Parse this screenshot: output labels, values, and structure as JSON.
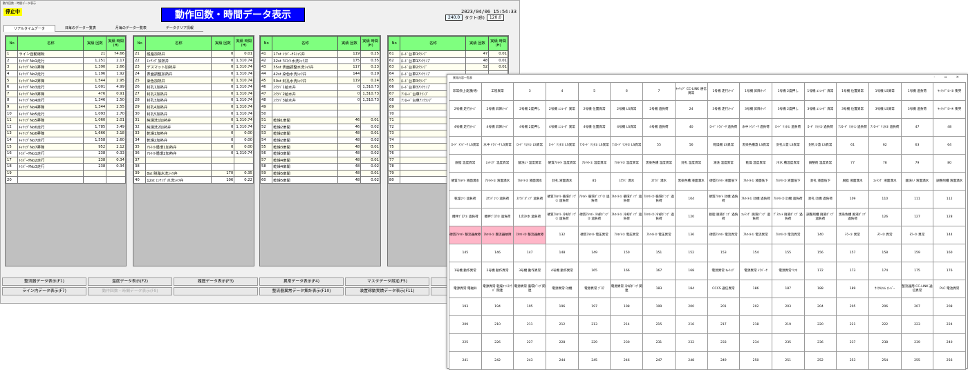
{
  "window1": {
    "title": "動作回数・時間データ表示",
    "status": "停止中",
    "heading": "動作回数・時間データ表示",
    "datetime": "2023/04/06 15:54:33",
    "cycle": "240.0",
    "takt_label": "タクト(秒)",
    "takt": "120.0",
    "tabs": [
      "リアルタイムデータ",
      "日毎のデータ一覧表",
      "月毎のデータ一覧表",
      "データクリア情報"
    ],
    "headers": {
      "no": "No",
      "name": "名称",
      "count": "実績 回数",
      "time": "実績 時間(H)"
    },
    "panels": [
      {
        "rows": [
          [
            "1",
            "ライン自動運転",
            "21",
            "74.66"
          ],
          [
            "2",
            "ｷｬﾘｯﾂﾞNo1走行",
            "1,251",
            "2.17"
          ],
          [
            "3",
            "ｷｬﾘｯﾂﾞNo1昇降",
            "1,390",
            "2.66"
          ],
          [
            "4",
            "ｷｬﾘｯﾂﾞNo2走行",
            "1,196",
            "1.92"
          ],
          [
            "5",
            "ｷｬﾘｯﾂﾞNo2昇降",
            "1,544",
            "2.95"
          ],
          [
            "6",
            "ｷｬﾘｯﾂﾞNo3走行",
            "1,001",
            "4.99"
          ],
          [
            "7",
            "ｷｬﾘｯﾂﾞNo3昇降",
            "476",
            "0.91"
          ],
          [
            "8",
            "ｷｬﾘｯﾂﾞNo4走行",
            "1,346",
            "2.50"
          ],
          [
            "9",
            "ｷｬﾘｯﾂﾞNo4昇降",
            "1,344",
            "2.55"
          ],
          [
            "10",
            "ｷｬﾘｯﾂﾞNo5走行",
            "1,093",
            "2.70"
          ],
          [
            "11",
            "ｷｬﾘｯﾂﾞNo5昇降",
            "1,060",
            "2.01"
          ],
          [
            "12",
            "ｷｬﾘｯﾂﾞNo6走行",
            "1,785",
            "3.49"
          ],
          [
            "13",
            "ｷｬﾘｯﾂﾞNo6昇降",
            "1,666",
            "3.18"
          ],
          [
            "14",
            "ｷｬﾘｯﾂﾞNo7走行",
            "1,558",
            "2.60"
          ],
          [
            "15",
            "ｷｬﾘｯﾂﾞNo7昇降",
            "952",
            "2.12"
          ],
          [
            "16",
            "ﾄﾗﾊﾞｰｻNo1走行",
            "238",
            "0.33"
          ],
          [
            "17",
            "ﾄﾗﾊﾞｰｻNo2走行",
            "238",
            "0.34"
          ],
          [
            "18",
            "ﾄﾗﾊﾞｰｻNo3走行",
            "238",
            "0.34"
          ],
          [
            "19",
            "",
            "",
            ""
          ],
          [
            "20",
            "",
            "",
            ""
          ]
        ]
      },
      {
        "rows": [
          [
            "21",
            "脱脂加熱弁",
            "0",
            "0.01"
          ],
          [
            "22",
            "ｴｯﾁﾝｸﾞ加熱弁",
            "0",
            "1,310.74"
          ],
          [
            "23",
            "デスマット加熱弁",
            "0",
            "1,310.74"
          ],
          [
            "24",
            "表面調整加熱弁",
            "0",
            "1,310.74"
          ],
          [
            "25",
            "染色加熱弁",
            "0",
            "1,310.74"
          ],
          [
            "26",
            "封孔1加熱弁",
            "0",
            "1,310.74"
          ],
          [
            "27",
            "封孔2加熱弁",
            "0",
            "1,310.74"
          ],
          [
            "28",
            "封孔3加熱弁",
            "0",
            "1,310.74"
          ],
          [
            "29",
            "封孔4加熱弁",
            "0",
            "1,310.74"
          ],
          [
            "30",
            "封孔5加熱弁",
            "0",
            "1,310.74"
          ],
          [
            "31",
            "純湯洗1加熱弁",
            "0",
            "1,310.74"
          ],
          [
            "32",
            "純湯洗2加熱弁",
            "0",
            "1,310.74"
          ],
          [
            "33",
            "乾燥1加熱弁",
            "0",
            "0.00"
          ],
          [
            "34",
            "乾燥2加熱弁",
            "0",
            "0.00"
          ],
          [
            "35",
            "ｱﾙﾏｲﾄ循環1加熱弁",
            "0",
            "0.00"
          ],
          [
            "36",
            "ｱﾙﾏｲﾄ循環2加熱弁",
            "0",
            "1,310.74"
          ],
          [
            "37",
            "",
            "",
            ""
          ],
          [
            "38",
            "",
            "",
            ""
          ],
          [
            "39",
            "8st 脱脂水洗ｼｬﾜ弁",
            "170",
            "0.35"
          ],
          [
            "40",
            "12st ｴｯﾁﾝｸﾞ水洗ｼｬﾜ弁",
            "106",
            "0.22"
          ]
        ]
      },
      {
        "rows": [
          [
            "41",
            "17st ﾄﾗﾊﾞｰｻ1ｼｬﾜ弁",
            "119",
            "0.25"
          ],
          [
            "42",
            "32st ｱﾙﾏｲﾄ水洗ｼｬﾜ弁",
            "175",
            "0.35"
          ],
          [
            "43",
            "35st 表面調整水洗ｼｬﾜ弁",
            "117",
            "0.23"
          ],
          [
            "44",
            "42st 染色水洗ｼｬﾜ弁",
            "144",
            "0.29"
          ],
          [
            "45",
            "50st 封孔水洗ｼｬﾜ弁",
            "119",
            "0.24"
          ],
          [
            "46",
            "ｽｸﾗﾊﾞ1給水弁",
            "0",
            "1,310.73"
          ],
          [
            "47",
            "ｽｸﾗﾊﾞ2給水弁",
            "0",
            "1,310.73"
          ],
          [
            "48",
            "ｽｸﾗﾊﾞ3給水弁",
            "0",
            "1,310.73"
          ],
          [
            "49",
            "",
            "",
            ""
          ],
          [
            "50",
            "",
            "",
            ""
          ],
          [
            "51",
            "乾燥1扉開",
            "46",
            "0.01"
          ],
          [
            "52",
            "乾燥2扉開",
            "46",
            "0.02"
          ],
          [
            "53",
            "乾燥2扉開",
            "48",
            "0.01"
          ],
          [
            "54",
            "乾燥2扉開",
            "48",
            "0.02"
          ],
          [
            "55",
            "乾燥3扉開",
            "48",
            "0.01"
          ],
          [
            "56",
            "乾燥3扉開",
            "48",
            "0.02"
          ],
          [
            "57",
            "乾燥4扉開",
            "48",
            "0.01"
          ],
          [
            "58",
            "乾燥4扉開",
            "48",
            "0.02"
          ],
          [
            "59",
            "乾燥5扉開",
            "48",
            "0.01"
          ],
          [
            "60",
            "乾燥5扉開",
            "48",
            "0.02"
          ]
        ]
      },
      {
        "rows": [
          [
            "61",
            "ﾛｰﾄﾞ台車1ｸﾗﾝﾌﾟ",
            "47",
            "0.01"
          ],
          [
            "62",
            "ﾛｰﾄﾞ台車1ｱﾝｸﾗﾝﾌﾟ",
            "48",
            "0.01"
          ],
          [
            "63",
            "ﾛｰﾄﾞ台車2ｸﾗﾝﾌﾟ",
            "52",
            "0.01"
          ],
          [
            "64",
            "ﾛｰﾄﾞ台車2ｱﾝｸﾗﾝﾌﾟ",
            "",
            ""
          ],
          [
            "65",
            "ﾛｰﾄﾞ台車3ｸﾗﾝﾌﾟ",
            "",
            ""
          ],
          [
            "66",
            "ﾛｰﾄﾞ台車3ｱﾝｸﾗﾝﾌﾟ",
            "",
            ""
          ],
          [
            "67",
            "ｱﾝﾛｰﾄﾞ台車ｸﾗﾝﾌﾟ",
            "",
            ""
          ],
          [
            "68",
            "ｱﾝﾛｰﾄﾞ台車ｱﾝｸﾗﾝﾌﾟ",
            "",
            ""
          ],
          [
            "69",
            "",
            "",
            ""
          ],
          [
            "70",
            "",
            "",
            ""
          ],
          [
            "71",
            "",
            "",
            ""
          ],
          [
            "72",
            "",
            "",
            ""
          ],
          [
            "73",
            "",
            "",
            ""
          ],
          [
            "74",
            "",
            "",
            ""
          ],
          [
            "75",
            "",
            "",
            ""
          ],
          [
            "76",
            "",
            "",
            ""
          ],
          [
            "77",
            "",
            "",
            ""
          ],
          [
            "78",
            "",
            "",
            ""
          ],
          [
            "79",
            "",
            "",
            ""
          ],
          [
            "80",
            "",
            "",
            ""
          ]
        ]
      }
    ],
    "buttons_row1": [
      "整流器データ表示(F1)",
      "温度データ表示(F2)",
      "履歴データ表示(F3)",
      "異常データ表示(F4)",
      "マスタデータ設定(F5)",
      ""
    ],
    "buttons_row2": [
      "ライン内データ表示(F7)",
      "動作回数・時間データ表示(F8)",
      "",
      "整流器異常データ集計表示(F10)",
      "装置稼動実績データ表示(F11)",
      ""
    ]
  },
  "window2": {
    "title": "異常内容一覧表",
    "controls": "- ▫ ×",
    "cells": [
      "非常停止(起動待)",
      "工程異常",
      "3",
      "4",
      "5",
      "6",
      "7",
      "ｷｬﾘｯﾂﾞ CC-LINK 通信異常",
      "1号機 走行ｵｰﾊﾞ",
      "1号機 昇降ｵｰﾊﾞ",
      "1号機 2度押し",
      "1号機 ｴﾝｺｰﾀﾞ 異常",
      "1号機 位置異常",
      "1号機 LS異常",
      "1号機 過負荷",
      "ｷｬﾘｯﾂﾞ①-② 衝突",
      "2号機 走行ｵｰﾊﾞ",
      "2号機 昇降ｵｰﾊﾞ",
      "2号機 2度押し",
      "2号機 ｴﾝｺｰﾀﾞ 異常",
      "2号機 位置異常",
      "2号機 LS異常",
      "2号機 過負荷",
      "24",
      "3号機 走行ｵｰﾊﾞ",
      "3号機 昇降ｵｰﾊﾞ",
      "3号機 2度押し",
      "3号機 ｴﾝｺｰﾀﾞ 異常",
      "3号機 位置異常",
      "3号機 LS異常",
      "3号機 過負荷",
      "ｷｬﾘｯﾂﾞ③-④ 衝突",
      "4号機 走行ｵｰﾊﾞ",
      "4号機 昇降ｵｰﾊﾞ",
      "4号機 2度押し",
      "4号機 ｴﾝｺｰﾀﾞ 異常",
      "4号機 位置異常",
      "4号機 LS異常",
      "4号機 過負荷",
      "40",
      "ﾛｰﾄﾞ ﾄﾗﾊﾞｰｻ 過負荷",
      "水中 ﾄﾗﾊﾞｰｻ 過負荷",
      "ﾛｰﾄﾞ ﾘﾌﾀ① 過負荷",
      "ﾛｰﾄﾞ ﾘﾌﾀ② 過負荷",
      "ｱﾝﾛｰﾄﾞ ﾘﾌﾀ① 過負荷",
      "ｱﾝﾛｰﾄﾞ ﾘﾌﾀ② 過負荷",
      "47",
      "48",
      "ﾛｰﾄﾞ ﾄﾗﾊﾞｰｻ LS異常",
      "水中 ﾄﾗﾊﾞｰｻ LS異常",
      "ﾛｰﾄﾞ ﾘﾌﾀ① LS異常",
      "ﾛｰﾄﾞ ﾘﾌﾀ② LS異常",
      "ｱﾝﾛｰﾄﾞ ﾘﾌﾀ① LS異常",
      "ｱﾝﾛｰﾄﾞ ﾘﾌﾀ② LS異常",
      "55",
      "56",
      "乾燥機 LS異常",
      "黒染色槽蓋 LS異常",
      "封孔①蓋 LS異常",
      "封孔②蓋 LS異常",
      "61",
      "62",
      "63",
      "64",
      "脱脂 温度異常",
      "ｴｯﾁﾝｸﾞ 温度異常",
      "酸洗い 温度異常",
      "硬質ｱﾙﾏｲﾄ 温度異常",
      "ｱﾙﾏｲﾄ① 温度異常",
      "ｱﾙﾏｲﾄ② 温度異常",
      "黒染色槽 温度異常",
      "封孔 温度異常",
      "湯洗 温度異常",
      "乾燥 温度異常",
      "冷水 槽温度異常",
      "調整剤 温度異常",
      "77",
      "78",
      "79",
      "80",
      "硬質ｱﾙﾏｲﾄ 液面満水",
      "ｱﾙﾏｲﾄ① 液面満水",
      "ｱﾙﾏｲﾄ② 液面満水",
      "封孔 液面満水",
      "85",
      "ｽｸﾗﾊﾞ 満水",
      "ｽｸﾗﾊﾞ 満水",
      "黒染色槽 液面満水",
      "硬質ｱﾙﾏｲﾄ 液面低下",
      "ｱﾙﾏｲﾄ① 液面低下",
      "ｱﾙﾏｲﾄ② 液面低下",
      "封孔 液面低下",
      "脱脂 液面満水",
      "ｴｯﾁﾝｸﾞ 液面満水",
      "酸洗い 液面満水",
      "調整剤槽 液面満水",
      "乾燥ﾌｧﾝ 過負荷",
      "ｽｸﾗﾊﾞﾌｧﾝ 過負荷",
      "ｽｸﾗﾊﾞﾎﾟﾝﾌﾟ 過負荷",
      "硬質ｱﾙﾏｲﾄ 循環ﾎﾟﾝﾌﾟ① 過負荷",
      "ｱﾙﾏｲﾄ 循環ﾎﾟﾝﾌﾟ② 過負荷",
      "ｱﾙﾏｲﾄ① 循環ﾎﾟﾝﾌﾟ 過負荷",
      "ｱﾙﾏｲﾄ② 循環ﾎﾟﾝﾌﾟ 過負荷",
      "104",
      "硬質ｱﾙﾏｲﾄ ﾛｶ機 過負荷",
      "ｱﾙﾏｲﾄ① ﾛｶ機 過負荷",
      "ｱﾙﾏｲﾄ② ﾛｶ機 過負荷",
      "封孔 ﾛｶ機 過負荷",
      "109",
      "110",
      "111",
      "112",
      "攪拌ﾌﾞﾛｱ① 過負荷",
      "攪拌ﾌﾞﾛｱ② 過負荷",
      "1次冷水 過負荷",
      "硬質ｱﾙﾏｲﾄ 冷却ﾎﾟﾝﾌﾟ① 過負荷",
      "硬質ｱﾙﾏｲﾄ 冷却ﾎﾟﾝﾌﾟ② 過負荷",
      "ｱﾙﾏｲﾄ① 冷却ﾎﾟﾝﾌﾟ 過負荷",
      "ｱﾙﾏｲﾄ② 冷却ﾎﾟﾝﾌﾟ 過負荷",
      "120",
      "脱脂 廃液ﾎﾟﾝﾌﾟ 過負荷",
      "ｴｯﾁﾝｸﾞ 廃液ﾎﾟﾝﾌﾟ 過負荷",
      "ﾃﾞｽﾏｯﾄ 廃液ﾎﾟﾝﾌﾟ 過負荷",
      "調整剤槽 廃液ﾎﾟﾝﾌﾟ 過負荷",
      "黒染色槽 廃液ﾎﾟﾝﾌﾟ 過負荷",
      "126",
      "127",
      "128",
      "硬質ｱﾙﾏｲﾄ 整流器故障",
      "ｱﾙﾏｲﾄ① 整流器故障",
      "ｱﾙﾏｲﾄ② 整流器故障",
      "132",
      "硬質ｱﾙﾏｲﾄ 電圧異常",
      "ｱﾙﾏｲﾄ① 電圧異常",
      "ｱﾙﾏｲﾄ② 電圧異常",
      "136",
      "硬質ｱﾙﾏｲﾄ 電流異常",
      "ｱﾙﾏｲﾄ① 電流異常",
      "ｱﾙﾏｲﾄ② 電流異常",
      "140",
      "ﾁﾗｰ① 異常",
      "ﾁﾗｰ② 異常",
      "ﾁﾗｰ③ 異常",
      "144",
      "145",
      "146",
      "147",
      "148",
      "149",
      "150",
      "151",
      "152",
      "153",
      "154",
      "155",
      "156",
      "157",
      "158",
      "159",
      "160",
      "1号機 動作異常",
      "2号機 動作異常",
      "3号機 動作異常",
      "4号機 動作異常",
      "165",
      "166",
      "167",
      "168",
      "電源異常 ｷｬﾘｯﾂﾞ",
      "電源異常 ﾄﾗﾊﾞｰｻ",
      "電源異常 ﾘﾌﾀ",
      "172",
      "173",
      "174",
      "175",
      "176",
      "電源異常 電磁弁",
      "電源異常 乾燥ﾌｧﾝｽｸﾗﾊﾞ 関連",
      "電源異常 循環ﾎﾟﾝﾌﾟ関連",
      "電源異常 ﾛｶ機",
      "電源異常 ﾌﾞﾛｱ",
      "電源異常 冷却ﾎﾟﾝﾌﾟ関連",
      "183",
      "184",
      "CCCS 通信異常",
      "186",
      "187",
      "188",
      "189",
      "ｻｲｸﾙﾀｲﾑ ｵｰﾊﾞｰ",
      "整流器用 CC-LINK 通信異常",
      "PLC 電池異常",
      "193",
      "194",
      "195",
      "196",
      "197",
      "198",
      "199",
      "200",
      "201",
      "202",
      "203",
      "204",
      "205",
      "206",
      "207",
      "208",
      "209",
      "210",
      "211",
      "212",
      "213",
      "214",
      "215",
      "216",
      "217",
      "218",
      "219",
      "220",
      "221",
      "222",
      "223",
      "224",
      "225",
      "226",
      "227",
      "228",
      "229",
      "230",
      "231",
      "232",
      "233",
      "234",
      "235",
      "236",
      "237",
      "238",
      "239",
      "240",
      "241",
      "242",
      "243",
      "244",
      "245",
      "246",
      "247",
      "248",
      "249",
      "250",
      "251",
      "252",
      "253",
      "254",
      "255",
      "256"
    ],
    "active_alarm_indices": [
      128,
      129,
      130
    ],
    "alarm_color": "#ffb6c8"
  }
}
